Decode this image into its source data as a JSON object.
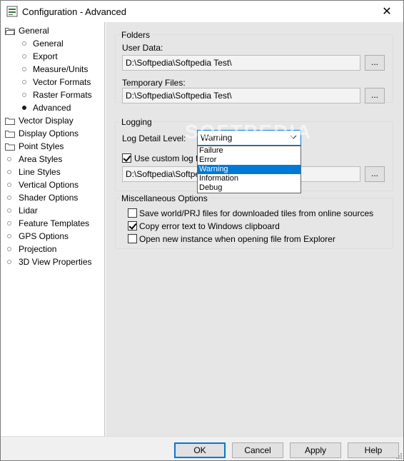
{
  "window": {
    "title": "Configuration - Advanced",
    "close_glyph": "✕"
  },
  "tree": {
    "items": [
      {
        "label": "General",
        "kind": "folder-open"
      },
      {
        "label": "General",
        "kind": "child"
      },
      {
        "label": "Export",
        "kind": "child"
      },
      {
        "label": "Measure/Units",
        "kind": "child"
      },
      {
        "label": "Vector Formats",
        "kind": "child"
      },
      {
        "label": "Raster Formats",
        "kind": "child"
      },
      {
        "label": "Advanced",
        "kind": "child-selected"
      },
      {
        "label": "Vector Display",
        "kind": "folder"
      },
      {
        "label": "Display Options",
        "kind": "folder"
      },
      {
        "label": "Point Styles",
        "kind": "folder"
      },
      {
        "label": "Area Styles",
        "kind": "leaf"
      },
      {
        "label": "Line Styles",
        "kind": "leaf"
      },
      {
        "label": "Vertical Options",
        "kind": "leaf"
      },
      {
        "label": "Shader Options",
        "kind": "leaf"
      },
      {
        "label": "Lidar",
        "kind": "leaf"
      },
      {
        "label": "Feature Templates",
        "kind": "leaf"
      },
      {
        "label": "GPS Options",
        "kind": "leaf"
      },
      {
        "label": "Projection",
        "kind": "leaf"
      },
      {
        "label": "3D View Properties",
        "kind": "leaf"
      }
    ]
  },
  "folders": {
    "title": "Folders",
    "user_data_label": "User Data:",
    "user_data_value": "D:\\Softpedia\\Softpedia Test\\",
    "temp_files_label": "Temporary Files:",
    "temp_files_value": "D:\\Softpedia\\Softpedia Test\\",
    "browse_label": "..."
  },
  "logging": {
    "title": "Logging",
    "detail_label": "Log Detail Level:",
    "detail_value": "Warning",
    "options": [
      "Failure",
      "Error",
      "Warning",
      "Information",
      "Debug"
    ],
    "highlighted_option": "Warning",
    "custom_log_label": "Use custom log file",
    "custom_log_checked": true,
    "custom_log_path": "D:\\Softpedia\\Softpedia",
    "browse_label": "..."
  },
  "misc": {
    "title": "Miscellaneous Options",
    "options": [
      {
        "label": "Save world/PRJ files for downloaded tiles from online sources",
        "checked": false
      },
      {
        "label": "Copy error text to Windows clipboard",
        "checked": true
      },
      {
        "label": "Open new instance when opening file from Explorer",
        "checked": false
      }
    ]
  },
  "buttons": {
    "ok": "OK",
    "cancel": "Cancel",
    "apply": "Apply",
    "help": "Help"
  },
  "watermark": "SOFTPEDIA",
  "colors": {
    "accent": "#0078d7",
    "folder": "#f5c04a",
    "selected_bullet": "#1a1a1a"
  }
}
